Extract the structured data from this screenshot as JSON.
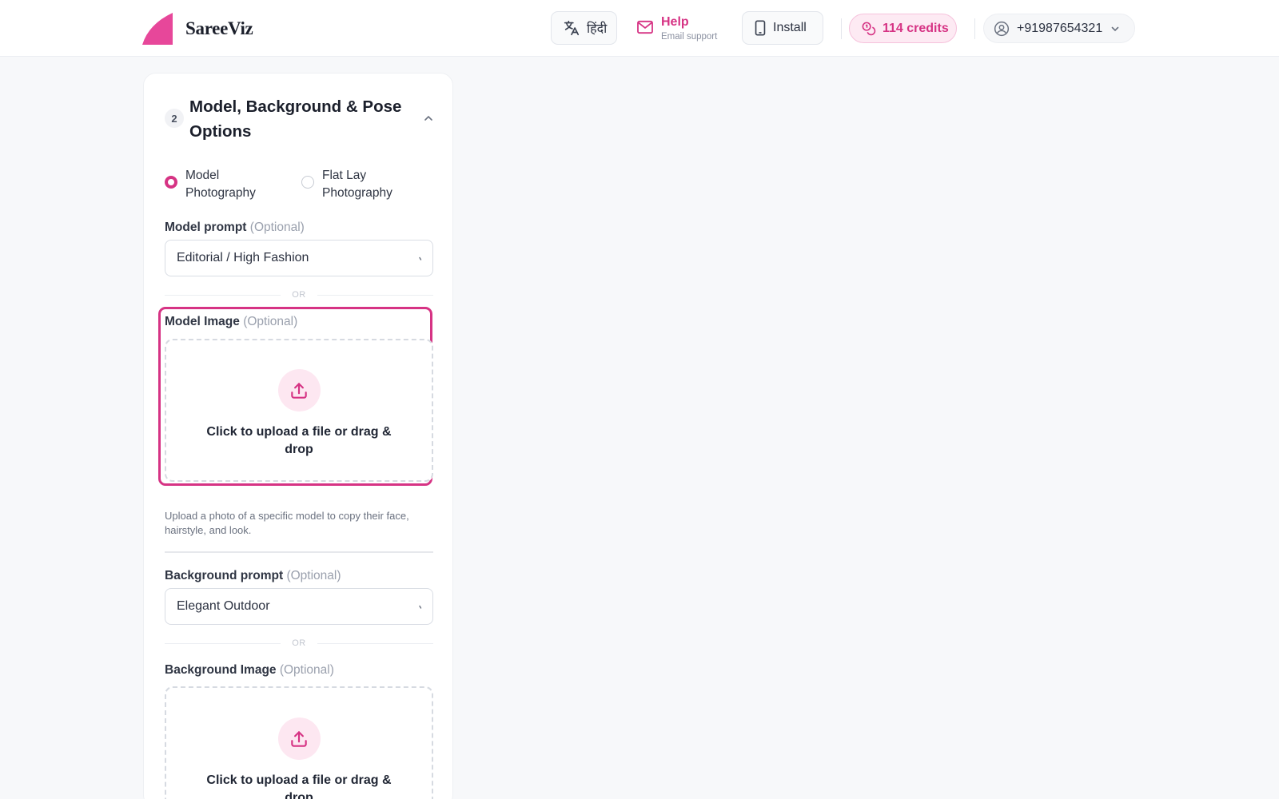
{
  "brand": {
    "name": "SareeViz",
    "accent": "#d63384"
  },
  "header": {
    "language_label": "हिंदी",
    "help_title": "Help",
    "help_subtitle": "Email support",
    "install_label": "Install",
    "credits_label": "114 credits",
    "user_phone": "+91987654321"
  },
  "section": {
    "step": "2",
    "title": "Model, Background & Pose Options"
  },
  "photo_type": {
    "options": [
      {
        "label": "Model Photography",
        "selected": true
      },
      {
        "label": "Flat Lay Photography",
        "selected": false
      }
    ]
  },
  "model_prompt": {
    "label": "Model prompt",
    "optional": "(Optional)",
    "value": "Editorial / High Fashion"
  },
  "divider_or": "OR",
  "model_image": {
    "label": "Model Image",
    "optional": "(Optional)",
    "upload_text": "Click to upload a file or drag & drop",
    "helper": "Upload a photo of a specific model to copy their face, hairstyle, and look."
  },
  "background_prompt": {
    "label": "Background prompt",
    "optional": "(Optional)",
    "value": "Elegant Outdoor"
  },
  "background_image": {
    "label": "Background Image",
    "optional": "(Optional)",
    "upload_text": "Click to upload a file or drag & drop"
  },
  "icons": {
    "logo": "brand-logo-icon",
    "language": "translate-icon",
    "help": "mail-icon",
    "install": "phone-icon",
    "credits": "coins-icon",
    "user": "user-circle-icon",
    "upload": "upload-icon"
  }
}
